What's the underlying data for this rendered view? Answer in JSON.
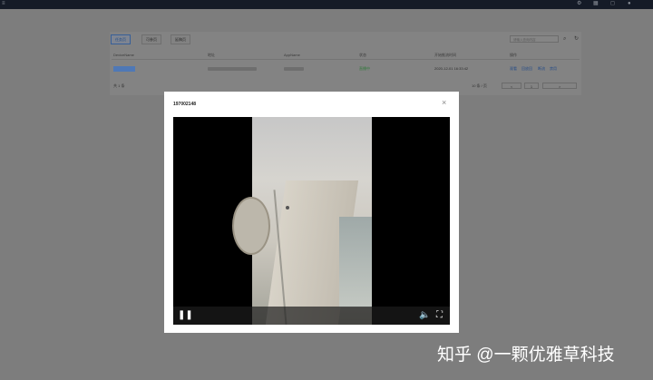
{
  "tabs": [
    {
      "label": "任务页",
      "active": true
    },
    {
      "label": "可参页",
      "active": false
    },
    {
      "label": "延稿页",
      "active": false
    }
  ],
  "search": {
    "placeholder": "请输入查询内容"
  },
  "table": {
    "headers": [
      "DeviceName",
      "地址",
      "AppName",
      "状态",
      "开始推流时间",
      "操作"
    ],
    "row": {
      "status": "直播中",
      "start_time": "2020-12-01 16:33:42",
      "actions": [
        "观看",
        "回放回",
        "断流",
        "禁用"
      ]
    }
  },
  "pagination": {
    "total": "共 1 条",
    "page_size": "10 条 / 页",
    "prev": "<",
    "page": "1",
    "next": ">"
  },
  "modal": {
    "title": "197002148",
    "close": "×"
  },
  "video": {
    "pause_icon": "pause-icon",
    "volume_icon": "volume-icon",
    "fullscreen_icon": "fullscreen-icon"
  },
  "watermark": "知乎 @一颗优雅草科技",
  "colors": {
    "overlay": "#7d7d7d",
    "topbar": "#151b27",
    "accent": "#264c87",
    "status_ok": "#2f7a3a"
  }
}
